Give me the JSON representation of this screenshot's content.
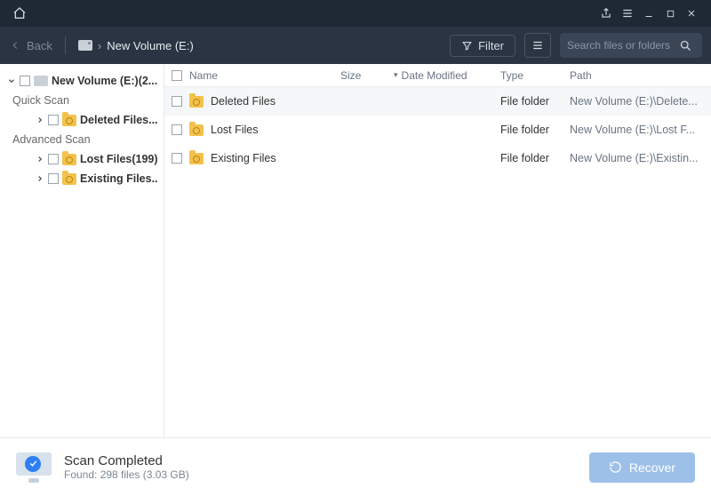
{
  "titlebar": {},
  "toolbar": {
    "back_label": "Back",
    "breadcrumb": "New Volume (E:)",
    "filter_label": "Filter",
    "search_placeholder": "Search files or folders"
  },
  "sidebar": {
    "root_label": "New Volume (E:)(2...",
    "quick_scan_label": "Quick Scan",
    "advanced_scan_label": "Advanced Scan",
    "items": {
      "deleted": "Deleted Files...",
      "lost": "Lost Files(199)",
      "existing": "Existing Files..."
    }
  },
  "columns": {
    "name": "Name",
    "size": "Size",
    "date": "Date Modified",
    "type": "Type",
    "path": "Path"
  },
  "rows": [
    {
      "name": "Deleted Files",
      "type": "File folder",
      "path": "New Volume (E:)\\Delete..."
    },
    {
      "name": "Lost Files",
      "type": "File folder",
      "path": "New Volume (E:)\\Lost F..."
    },
    {
      "name": "Existing Files",
      "type": "File folder",
      "path": "New Volume (E:)\\Existin..."
    }
  ],
  "footer": {
    "title": "Scan Completed",
    "subtitle": "Found: 298 files (3.03 GB)",
    "recover_label": "Recover"
  }
}
